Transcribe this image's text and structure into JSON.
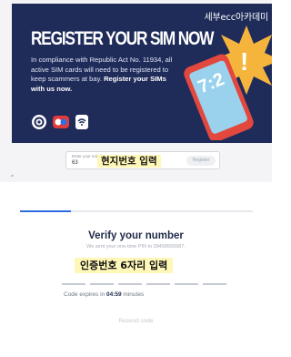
{
  "banner": {
    "watermark": "세부ecc아카데미",
    "headline": "REGISTER YOUR SIM NOW",
    "body_prefix": "In compliance with Republic Act No. 11934, all active SIM cards will need to be registered to keep scammers at bay.",
    "body_emphasis": "Register your SIMs with us now.",
    "phone_time": "7:2",
    "alert_symbol": "!",
    "logos": [
      "gov-seal-logo",
      "partner-logo",
      "agency-logo"
    ]
  },
  "registration": {
    "field_label": "Enter your mobile number",
    "country_code": "63",
    "overlay_text": "현지번호 입력",
    "button_label": "Register"
  },
  "verify": {
    "progress": 0.22,
    "title": "Verify your number",
    "sent_text": "We sent your one-time PIN to 09458565987.",
    "code_overlay": "인증번호 6자리 입력",
    "otp_slots": 6,
    "expires_prefix": "Code expires in",
    "expires_time": "04:59",
    "expires_suffix": "minutes",
    "resend_label": "Resend code"
  },
  "colors": {
    "banner_bg": "#1f2c5a",
    "accent": "#2d6cdf",
    "highlight": "#fff7b8",
    "starburst": "#f5b53d",
    "phone": "#e3483f"
  }
}
